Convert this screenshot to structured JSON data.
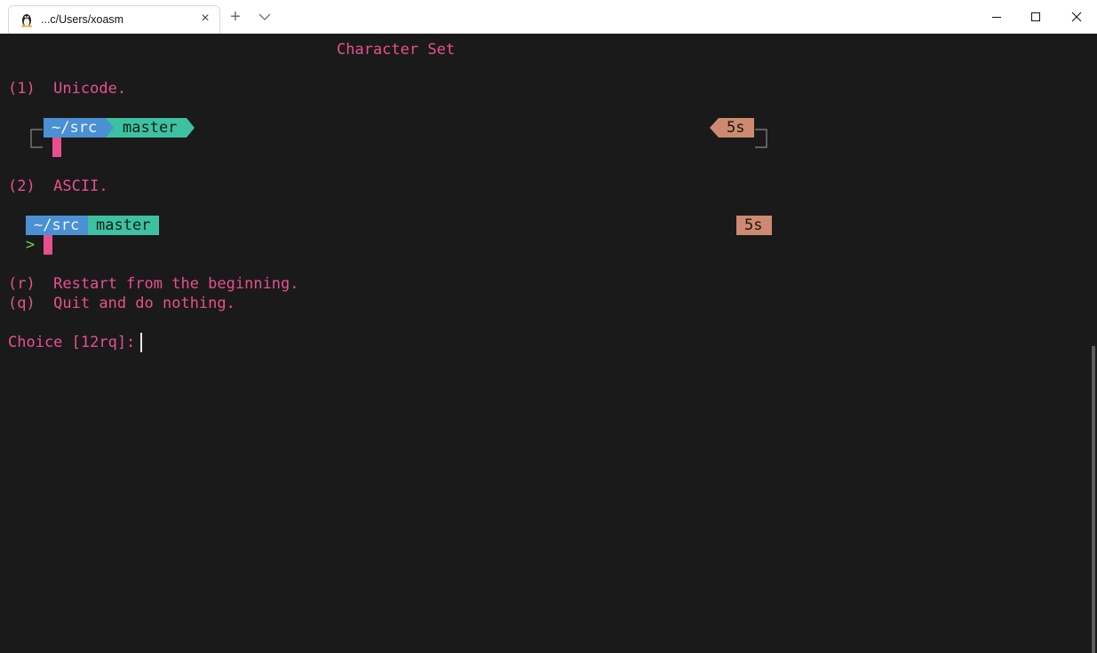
{
  "window": {
    "tab_title": "...c/Users/xoasm",
    "tab_icon": "linux-tux-icon",
    "new_tab_symbol": "+",
    "close_symbol": "×"
  },
  "terminal": {
    "heading": "Character Set",
    "option1": "(1)  Unicode.",
    "option2": "(2)  ASCII.",
    "unicode_prompt": {
      "dir": "~/src",
      "branch": "master",
      "time": "5s"
    },
    "ascii_prompt": {
      "dir": "~/src",
      "branch": "master",
      "time": "5s",
      "prompt_char": ">"
    },
    "option_r": "(r)  Restart from the beginning.",
    "option_q": "(q)  Quit and do nothing.",
    "choice_prompt": "Choice [12rq]: "
  },
  "colors": {
    "background": "#1a1a1a",
    "text_pink": "#e8508d",
    "dir_segment": "#4a90d2",
    "branch_segment": "#3ec1a0",
    "time_segment": "#cd8a70",
    "prompt_green": "#6ed14a"
  }
}
